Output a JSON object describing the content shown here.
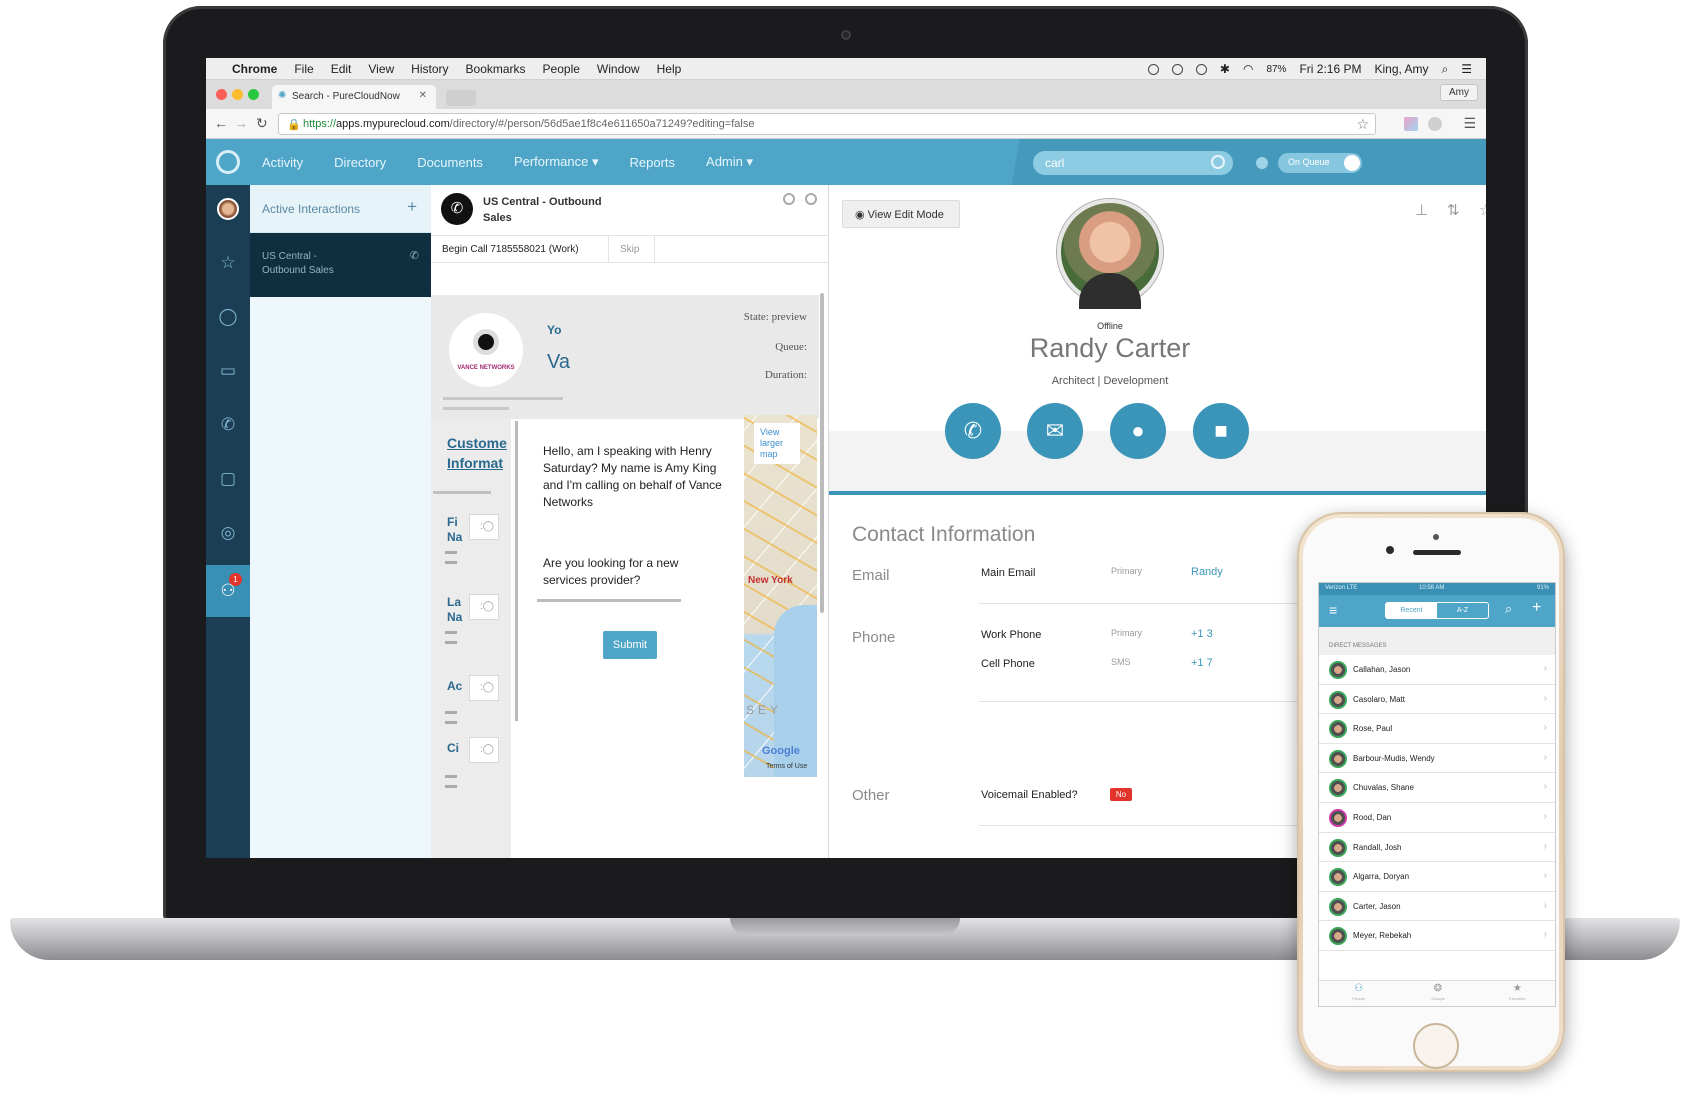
{
  "menubar": {
    "app": "Chrome",
    "items": [
      "File",
      "Edit",
      "View",
      "History",
      "Bookmarks",
      "People",
      "Window",
      "Help"
    ],
    "battery": "87%",
    "clock": "Fri 2:16 PM",
    "user": "King, Amy"
  },
  "browser": {
    "tab_title": "Search - PureCloudNow",
    "profile": "Amy",
    "url_scheme": "https://",
    "url_host": "apps.mypurecloud.com",
    "url_path": "/directory/#/person/56d5ae1f8c4e611650a71249?editing=false"
  },
  "app": {
    "nav": [
      {
        "label": "Activity"
      },
      {
        "label": "Directory"
      },
      {
        "label": "Documents"
      },
      {
        "label": "Performance ▾"
      },
      {
        "label": "Reports"
      },
      {
        "label": "Admin ▾"
      }
    ],
    "search_value": "carl",
    "queue_toggle": "On Queue"
  },
  "interactions": {
    "header": "Active Interactions",
    "add": "+",
    "card_line1": "US Central -",
    "card_line2": "Outbound Sales"
  },
  "script": {
    "title_line1": "US Central - Outbound",
    "title_line2": "Sales",
    "begin_call": "Begin Call 7185558021 (Work)",
    "skip": "Skip",
    "logo_text": "VANCE NETWORKS",
    "yo": "Yo",
    "va": "Va",
    "state": "State: preview",
    "queue": "Queue:",
    "duration": "Duration:",
    "customer_heading_1": "Custome",
    "customer_heading_2": "Informat",
    "fields": [
      {
        "l1": "Fi",
        "l2": "Na"
      },
      {
        "l1": "La",
        "l2": "Na"
      },
      {
        "l1": "Ac",
        "l2": ""
      },
      {
        "l1": "Ci",
        "l2": ""
      }
    ],
    "greeting": "Hello, am I speaking with Henry Saturday? My name is Amy King and I'm calling on behalf of Vance Networks",
    "question": "Are you looking for a new services provider?",
    "submit": "Submit",
    "map_link": "View larger map",
    "map_city": "New York",
    "map_region": "SEY",
    "map_google": "Google",
    "map_terms": "Terms of Use"
  },
  "profile": {
    "edit_mode": "View Edit Mode",
    "presence": "Offline",
    "name": "Randy Carter",
    "title": "Architect | Development",
    "contact_heading": "Contact Information",
    "email_label": "Email",
    "main_email": "Main Email",
    "primary": "Primary",
    "email_value": "Randy",
    "phone_label": "Phone",
    "work_phone": "Work Phone",
    "work_value": "+1 3",
    "cell_phone": "Cell Phone",
    "sms": "SMS",
    "cell_value": "+1 7",
    "other_label": "Other",
    "voicemail": "Voicemail Enabled?",
    "voicemail_value": "No"
  },
  "phone": {
    "carrier": "Verizon LTE",
    "time": "10:58 AM",
    "battery": "91%",
    "tab_recent": "Recent",
    "tab_az": "A-Z",
    "section": "DIRECT MESSAGES",
    "contacts": [
      {
        "name": "Callahan, Jason"
      },
      {
        "name": "Casolaro, Matt"
      },
      {
        "name": "Rose, Paul"
      },
      {
        "name": "Barbour-Mudis, Wendy"
      },
      {
        "name": "Chuvalas, Shane"
      },
      {
        "name": "Rood, Dan"
      },
      {
        "name": "Randall, Josh"
      },
      {
        "name": "Algarra, Doryan"
      },
      {
        "name": "Carter, Jason"
      },
      {
        "name": "Meyer, Rebekah"
      }
    ],
    "bottom_tabs": [
      "People",
      "Groups",
      "Favorites"
    ]
  },
  "colors": {
    "brand": "#4ea5c8",
    "rail": "#1c3e55",
    "action_button": "#3a95b9",
    "alert": "#e2342b"
  }
}
